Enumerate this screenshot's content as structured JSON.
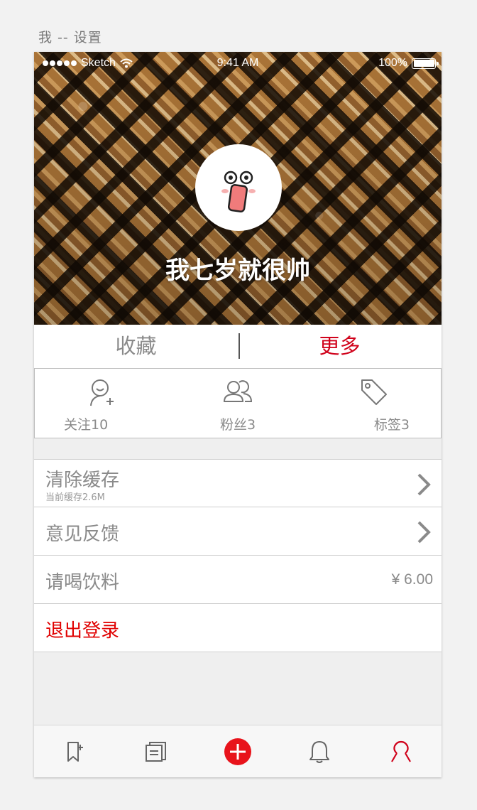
{
  "artboard": {
    "title": "我 -- 设置"
  },
  "status_bar": {
    "carrier": "Sketch",
    "time": "9:41 AM",
    "battery": "100%"
  },
  "profile": {
    "nickname": "我七岁就很帅"
  },
  "tabs": [
    {
      "label": "收藏",
      "active": false
    },
    {
      "label": "更多",
      "active": true
    }
  ],
  "stats": [
    {
      "label": "关注10",
      "icon": "add-user-icon"
    },
    {
      "label": "粉丝3",
      "icon": "users-icon"
    },
    {
      "label": "标签3",
      "icon": "tag-icon"
    }
  ],
  "settings": {
    "clear_cache": {
      "title": "清除缓存",
      "subtitle": "当前缓存2.6M"
    },
    "feedback": {
      "title": "意见反馈"
    },
    "drink": {
      "title": "请喝饮料",
      "value": "¥ 6.00"
    },
    "logout": {
      "title": "退出登录"
    }
  },
  "tab_bar": [
    {
      "name": "bookmark-add-icon"
    },
    {
      "name": "notes-icon"
    },
    {
      "name": "add-icon"
    },
    {
      "name": "bell-icon"
    },
    {
      "name": "profile-icon",
      "active": true
    }
  ],
  "colors": {
    "accent": "#d0021b",
    "logout": "#e00000",
    "plus": "#e8131b",
    "text_gray": "#8a8a8a"
  }
}
